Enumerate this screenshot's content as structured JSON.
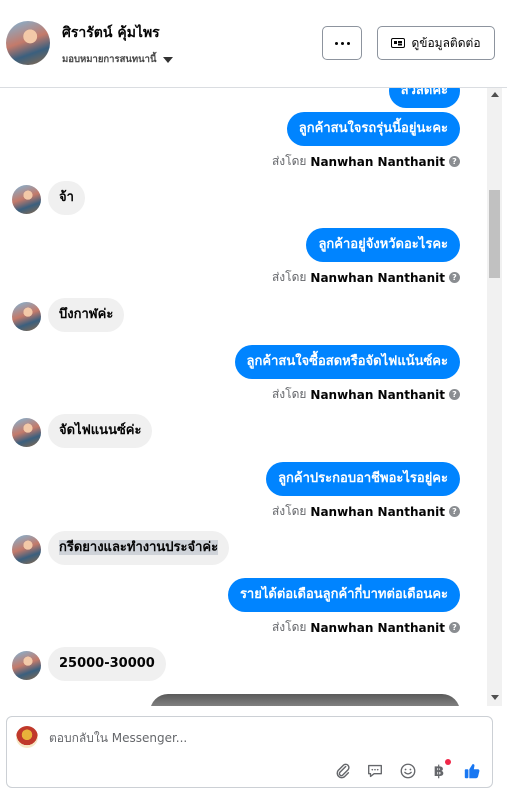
{
  "header": {
    "name": "ศิรารัตน์ คุ้มไพร",
    "subtitle": "มอบหมายการสนทนานี้",
    "more_icon": "more-dots-icon",
    "contact_button_label": "ดูข้อมูลติดต่อ"
  },
  "messages": [
    {
      "direction": "out",
      "text": "สวัสดีค่ะ"
    },
    {
      "direction": "out",
      "text": "ลูกค้าสนใจรถรุ่นนี้อยู่นะคะ"
    },
    {
      "direction": "meta",
      "prefix": "ส่งโดย",
      "sender": "Nanwhan Nanthanit"
    },
    {
      "direction": "in",
      "text": "จ้า"
    },
    {
      "direction": "out",
      "text": "ลูกค้าอยู่จังหวัดอะไรคะ"
    },
    {
      "direction": "meta",
      "prefix": "ส่งโดย",
      "sender": "Nanwhan Nanthanit"
    },
    {
      "direction": "in",
      "text": "บึงกาฬค่ะ"
    },
    {
      "direction": "out",
      "text": "ลูกค้าสนใจซื้อสดหรือจัดไฟแน้นซ์คะ"
    },
    {
      "direction": "meta",
      "prefix": "ส่งโดย",
      "sender": "Nanwhan Nanthanit"
    },
    {
      "direction": "in",
      "text": "จัดไฟแนนซ์ค่ะ"
    },
    {
      "direction": "out",
      "text": "ลูกค้าประกอบอาชีพอะไรอยู่คะ"
    },
    {
      "direction": "meta",
      "prefix": "ส่งโดย",
      "sender": "Nanwhan Nanthanit"
    },
    {
      "direction": "in",
      "text": "กรีดยางและทำงานประจำค่ะ"
    },
    {
      "direction": "out",
      "text": "รายได้ต่อเดือนลูกค้ากี่บาทต่อเดือนคะ"
    },
    {
      "direction": "meta",
      "prefix": "ส่งโดย",
      "sender": "Nanwhan Nanthanit"
    },
    {
      "direction": "in",
      "text": "25000-30000"
    }
  ],
  "composer": {
    "placeholder": "ตอบกลับใน Messenger...",
    "tools": [
      "attach-icon",
      "reply-icon",
      "emoji-icon",
      "baht-payment-icon",
      "thumbs-up-icon"
    ],
    "baht_symbol": "฿"
  },
  "colors": {
    "outgoing_bubble": "#0084ff",
    "incoming_bubble": "#f0f0f0",
    "like_icon": "#1877f2",
    "notification_dot": "#f02849"
  }
}
